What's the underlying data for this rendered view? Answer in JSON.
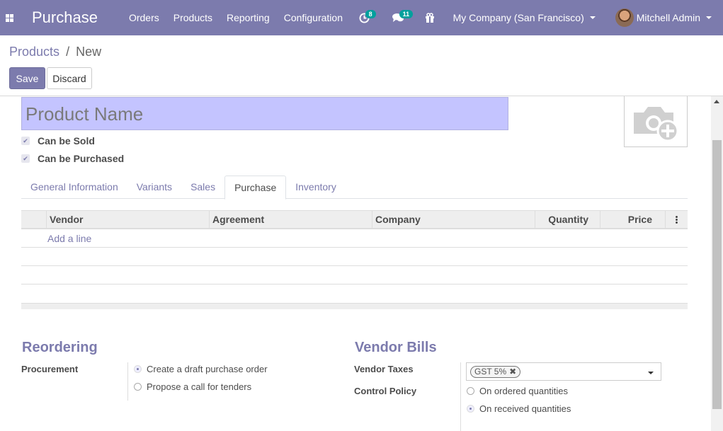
{
  "navbar": {
    "app_name": "Purchase",
    "menu": [
      "Orders",
      "Products",
      "Reporting",
      "Configuration"
    ],
    "activity_badge": "8",
    "messages_badge": "11",
    "company": "My Company (San Francisco)",
    "user": "Mitchell Admin",
    "bar_color": "#7c7bad"
  },
  "breadcrumb": {
    "parent": "Products",
    "separator": "/",
    "current": "New"
  },
  "buttons": {
    "save": "Save",
    "discard": "Discard"
  },
  "form": {
    "product_name_placeholder": "Product Name",
    "can_be_sold": "Can be Sold",
    "can_be_purchased": "Can be Purchased"
  },
  "tabs": [
    {
      "label": "General Information",
      "active": false
    },
    {
      "label": "Variants",
      "active": false
    },
    {
      "label": "Sales",
      "active": false
    },
    {
      "label": "Purchase",
      "active": true
    },
    {
      "label": "Inventory",
      "active": false
    }
  ],
  "vendor_table": {
    "columns": [
      "",
      "Vendor",
      "Agreement",
      "Company",
      "Quantity",
      "Price"
    ],
    "add_line": "Add a line"
  },
  "reordering": {
    "title": "Reordering",
    "procurement_label": "Procurement",
    "options": [
      "Create a draft purchase order",
      "Propose a call for tenders"
    ],
    "selected": 0
  },
  "vendor_bills": {
    "title": "Vendor Bills",
    "taxes_label": "Vendor Taxes",
    "tax_tag": "GST 5%",
    "control_label": "Control Policy",
    "control_options": [
      "On ordered quantities",
      "On received quantities"
    ],
    "selected": 1
  }
}
